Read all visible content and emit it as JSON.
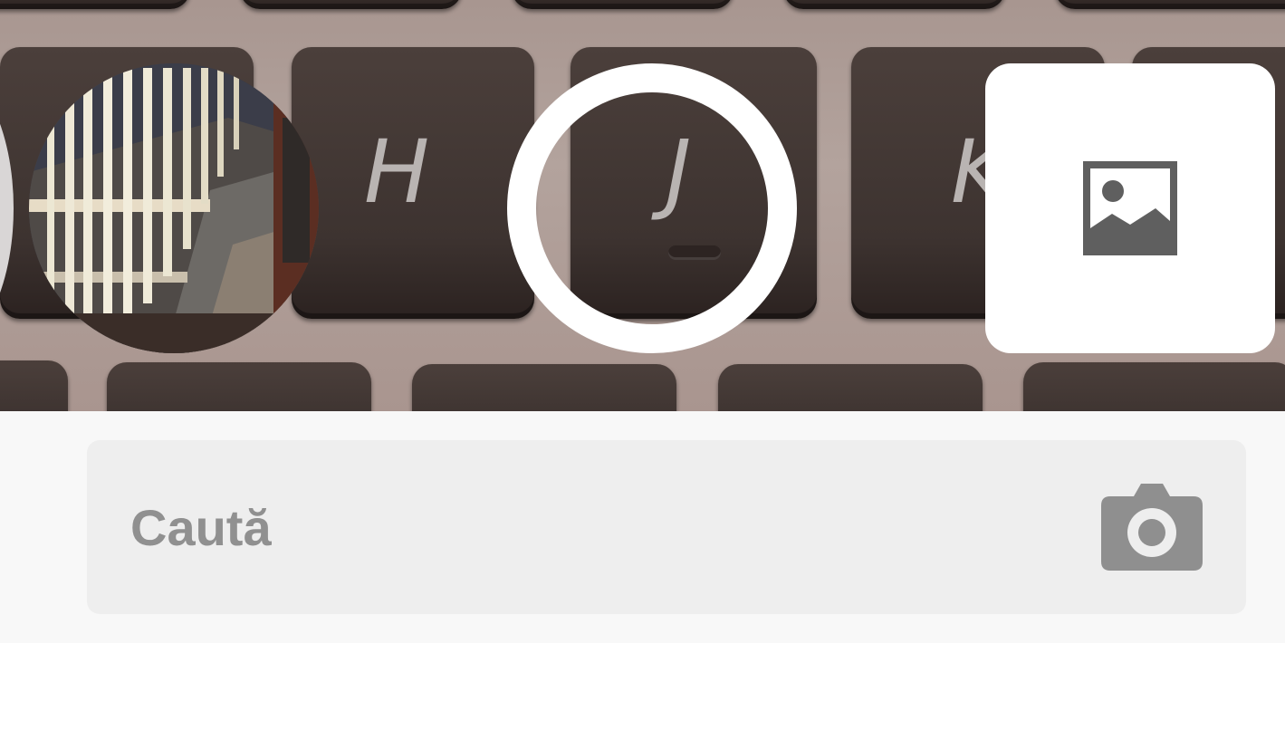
{
  "keyboard": {
    "letters": [
      "H",
      "J",
      "K"
    ]
  },
  "controls": {
    "gallery_thumbnail_icon": "staircase-photo",
    "shutter_icon": "shutter-ring",
    "image_picker_icon": "image-icon"
  },
  "search": {
    "placeholder": "Caută",
    "value": "",
    "camera_icon": "camera-icon"
  },
  "colors": {
    "panel_background": "#f8f8f8",
    "search_box": "#eeeeee",
    "placeholder_text": "#909090",
    "icon_gray": "#8f8f8f",
    "image_icon": "#5f5f5f",
    "card_white": "#ffffff"
  }
}
